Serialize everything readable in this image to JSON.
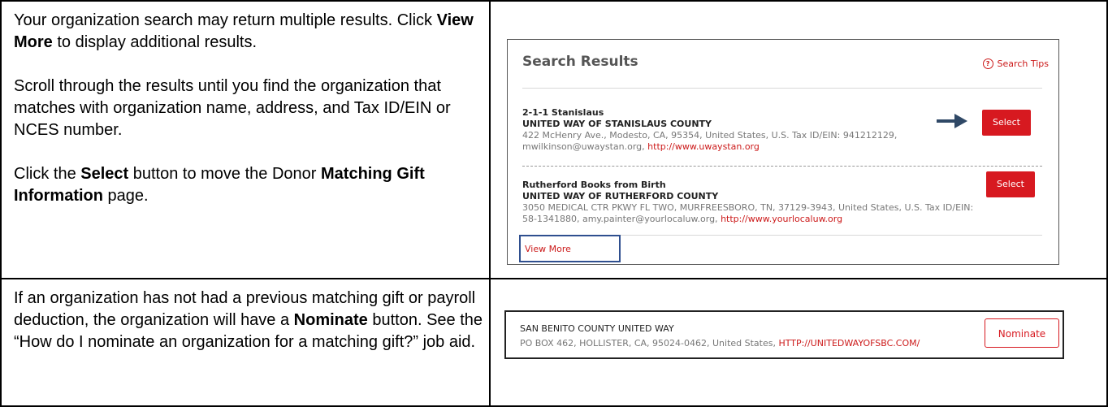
{
  "row1": {
    "instructions": {
      "p1_text_a": "Your organization search may return multiple results. Click ",
      "p1_bold": "View More",
      "p1_text_b": " to display additional results.",
      "p2": "Scroll through the results until you find the organization that matches with organization name, address, and Tax ID/EIN or NCES number.",
      "p3_text_a": "Click the ",
      "p3_bold_a": "Select",
      "p3_text_b": " button to move the Donor ",
      "p3_bold_b": "Matching Gift Information",
      "p3_text_c": " page."
    },
    "screenshot": {
      "title": "Search Results",
      "search_tips": "Search Tips",
      "search_tips_icon": "question-circle-icon",
      "results": [
        {
          "name": "2-1-1 Stanislaus",
          "parent": "UNITED WAY OF STANISLAUS COUNTY",
          "address_line1": "422 McHenry Ave., Modesto, CA, 95354, United States, U.S. Tax ID/EIN: 941212129,",
          "address_line2": "mwilkinson@uwaystan.org, ",
          "url": "http://www.uwaystan.org",
          "button": "Select"
        },
        {
          "name": "Rutherford Books from Birth",
          "parent": "UNITED WAY OF RUTHERFORD COUNTY",
          "address_line1": "3050 MEDICAL CTR PKWY FL TWO, MURFREESBORO, TN, 37129-3943, United States, U.S. Tax ID/EIN:",
          "address_line2": "58-1341880, amy.painter@yourlocaluw.org, ",
          "url": "http://www.yourlocaluw.org",
          "button": "Select"
        }
      ],
      "view_more": "View More",
      "accent_color": "#d71920",
      "highlight_color": "#2f4f8f"
    }
  },
  "row2": {
    "instructions": {
      "text_a": "If an organization has not had a previous matching gift or payroll deduction, the organization will have a ",
      "bold": "Nominate",
      "text_b": " button. See the “How do I nominate an organization for a matching gift?” job aid."
    },
    "screenshot": {
      "org_name": "SAN BENITO COUNTY UNITED WAY",
      "address": "PO BOX 462, HOLLISTER, CA, 95024-0462, United States, ",
      "url": "HTTP://UNITEDWAYOFSBC.COM/",
      "button": "Nominate"
    }
  }
}
